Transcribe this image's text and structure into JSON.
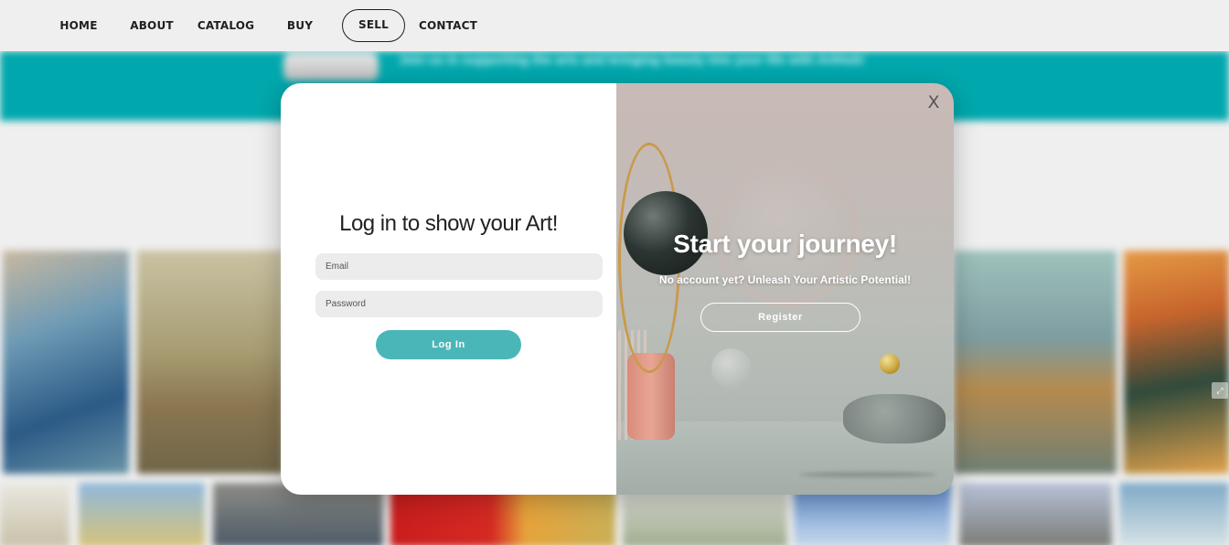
{
  "nav": {
    "items": [
      {
        "label": "HOME",
        "active": false
      },
      {
        "label": "ABOUT",
        "active": false
      },
      {
        "label": "CATALOG",
        "active": false
      },
      {
        "label": "BUY",
        "active": false
      },
      {
        "label": "SELL",
        "active": true
      },
      {
        "label": "CONTACT",
        "active": false
      }
    ]
  },
  "background": {
    "banner_text": "Join us in supporting the arts and bringing beauty into your life with ArtHub!",
    "accent_color": "#00a8ad"
  },
  "login": {
    "title": "Log in to show your Art!",
    "email_placeholder": "Email",
    "password_placeholder": "Password",
    "button_label": "Log In",
    "button_color": "#4bb6b8"
  },
  "register": {
    "title": "Start your journey!",
    "subtitle": "No account yet? Unleash Your Artistic Potential!",
    "button_label": "Register",
    "close_label": "X"
  }
}
